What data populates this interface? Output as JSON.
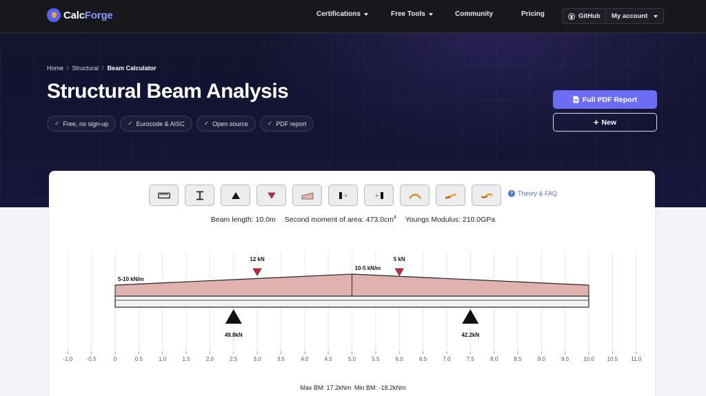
{
  "nav": {
    "logo_main": "Calc",
    "logo_accent": "Forge",
    "items": [
      {
        "label": "Certifications",
        "dropdown": true
      },
      {
        "label": "Free Tools",
        "dropdown": true
      },
      {
        "label": "Community",
        "dropdown": false
      },
      {
        "label": "Pricing",
        "dropdown": false
      }
    ],
    "github_label": "GitHub",
    "account_label": "My account"
  },
  "breadcrumb": [
    "Home",
    "Structural",
    "Beam Calculator"
  ],
  "page_title": "Structural Beam Analysis",
  "badges": [
    "Free, no sign-up",
    "Eurocode & AISC",
    "Open source",
    "PDF report"
  ],
  "actions": {
    "pdf_label": "Full PDF Report",
    "new_label": "New"
  },
  "toolbar": {
    "tools": [
      "length-tool",
      "section-tool",
      "support-tool",
      "point-load-tool",
      "distributed-load-tool",
      "moment-left-tool",
      "moment-right-tool",
      "arch-tool",
      "ramp-tool",
      "curve-tool"
    ],
    "theory_label": "Theory & FAQ"
  },
  "properties": {
    "length": "Beam length: 10.0m",
    "inertia": "Second moment of area: 473.0cm",
    "inertia_exp": "4",
    "modulus": "Youngs Modulus: 210.0GPa"
  },
  "beam": {
    "length": 10,
    "x_range": [
      -1,
      11
    ],
    "x_ticks": [
      "-1.0",
      "-0.5",
      "0",
      "0.5",
      "1.0",
      "1.5",
      "2.0",
      "2.5",
      "3.0",
      "3.5",
      "4.0",
      "4.5",
      "5.0",
      "5.5",
      "6.0",
      "6.5",
      "7.0",
      "7.5",
      "8.0",
      "8.5",
      "9.0",
      "9.5",
      "10.0",
      "10.5",
      "11.0"
    ],
    "point_loads": [
      {
        "x": 3,
        "label": "12 kN"
      },
      {
        "x": 6,
        "label": "5 kN"
      }
    ],
    "distributed_loads": [
      {
        "from": 0,
        "to": 5,
        "w_start": 5,
        "w_end": 10,
        "label": "5-10 kN/m"
      },
      {
        "from": 5,
        "to": 10,
        "w_start": 10,
        "w_end": 5,
        "label": "10-5 kN/m"
      }
    ],
    "supports": [
      {
        "x": 2.5,
        "label": "49.8kN"
      },
      {
        "x": 7.5,
        "label": "42.2kN"
      }
    ]
  },
  "summary": {
    "max_bm": "Max BM: 17.2kNm",
    "min_bm": "Min BM: -18.2kNm"
  },
  "colors": {
    "accent": "#6b6ef5",
    "hero_bg": "#14152a",
    "load_fill": "#dfb2b0",
    "point_load": "#d0243a"
  }
}
